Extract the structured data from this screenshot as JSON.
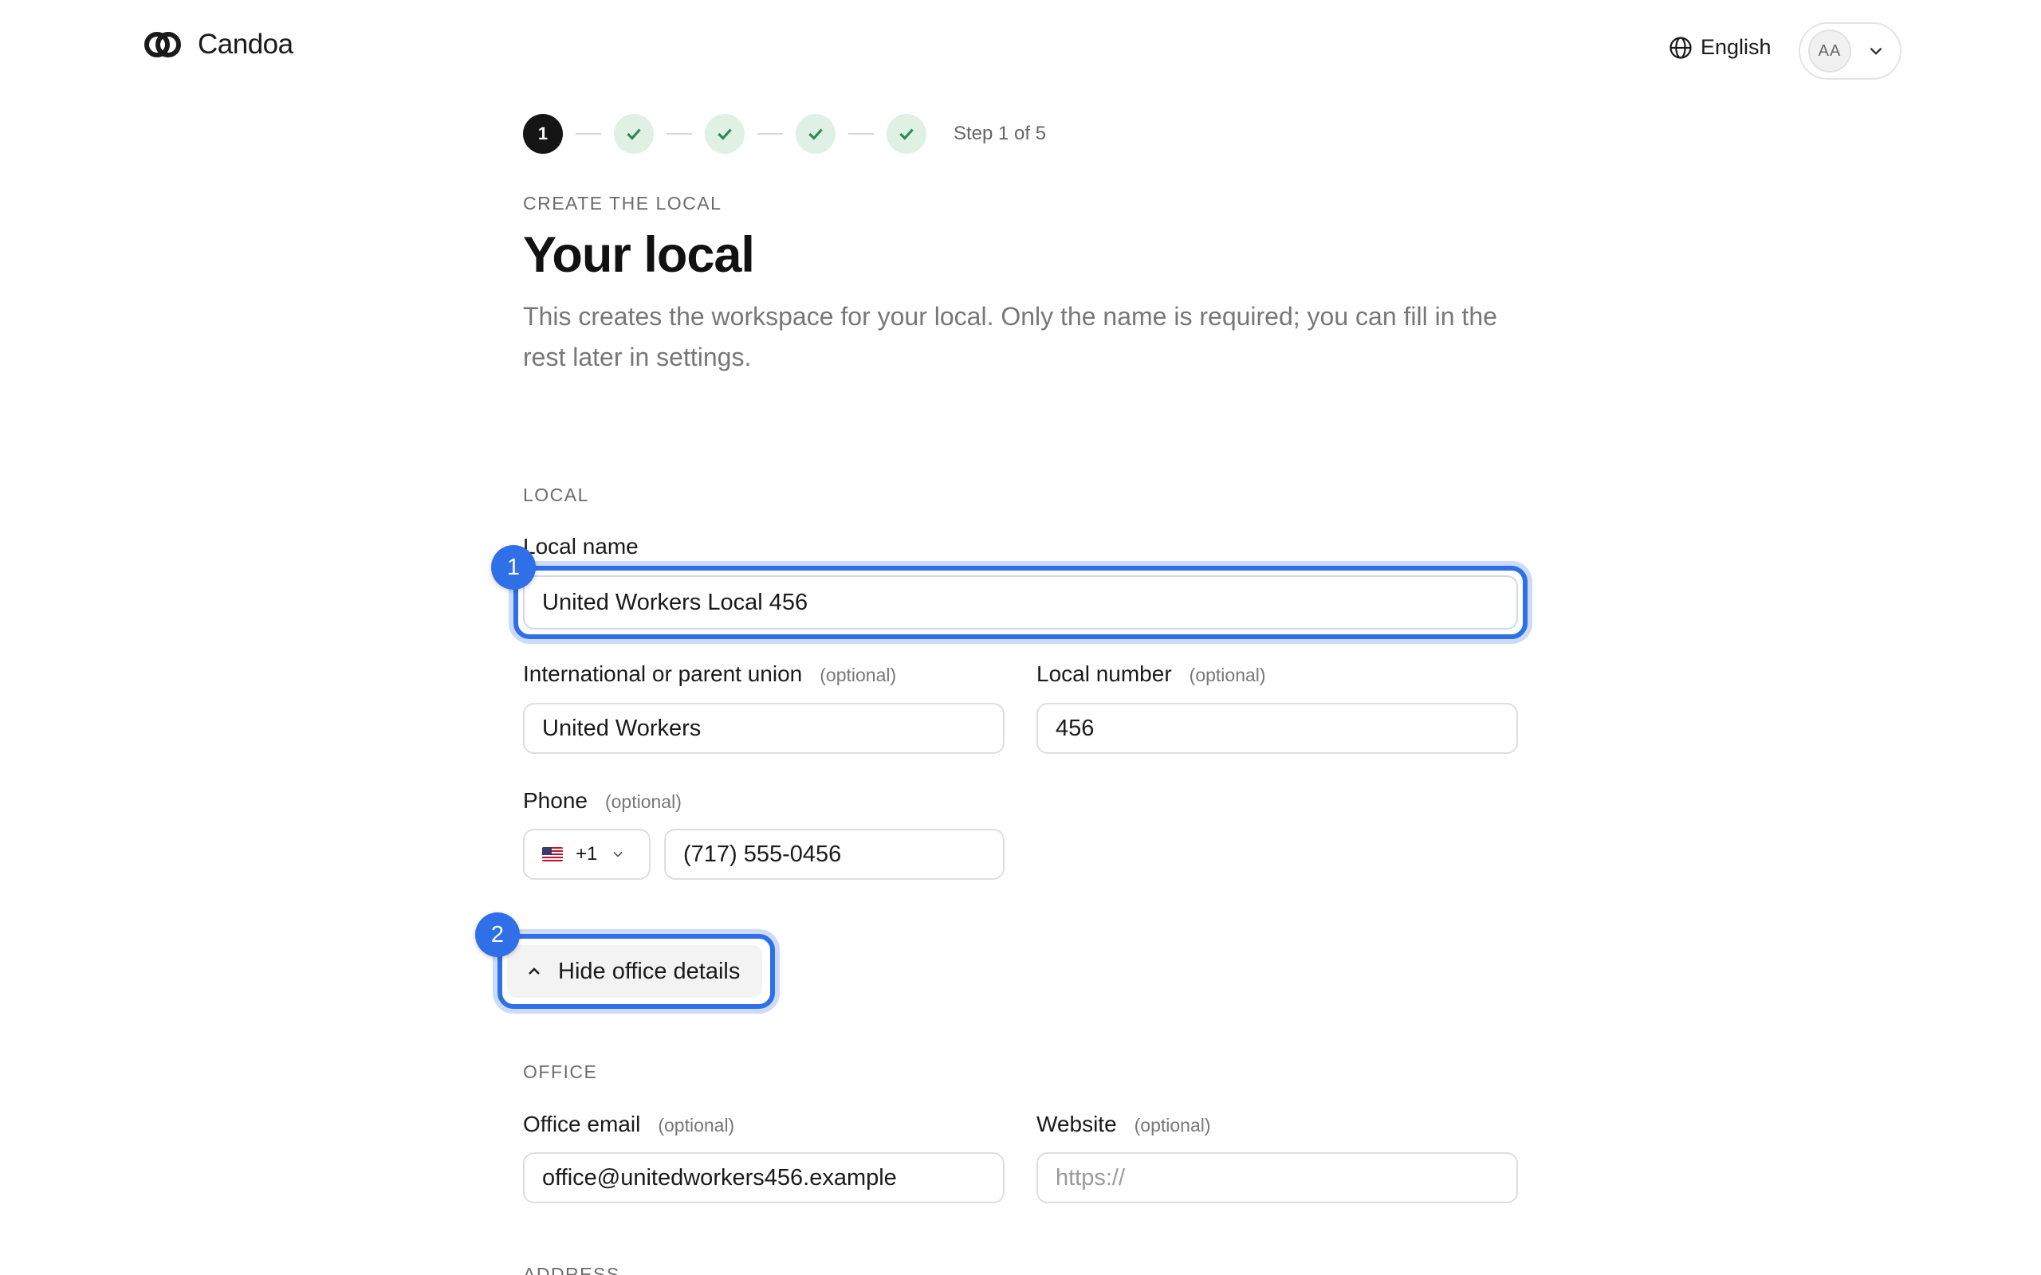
{
  "header": {
    "brand": "Candoa",
    "language": "English",
    "avatar_initials": "AA"
  },
  "stepper": {
    "current": "1",
    "text": "Step 1 of 5",
    "steps": [
      "active",
      "done",
      "done",
      "done",
      "done"
    ]
  },
  "page": {
    "eyebrow": "CREATE THE LOCAL",
    "title": "Your local",
    "intro": "This creates the workspace for your local. Only the name is required; you can fill in the rest later in settings."
  },
  "local": {
    "section": "LOCAL",
    "name_label": "Local name",
    "name_value": "United Workers Local 456",
    "parent_label": "International or parent union",
    "parent_value": "United Workers",
    "number_label": "Local number",
    "number_value": "456",
    "phone_label": "Phone",
    "phone_country_code": "+1",
    "phone_value": "(717) 555-0456",
    "optional": "(optional)"
  },
  "toggle": {
    "label": "Hide office details"
  },
  "office": {
    "section": "OFFICE",
    "email_label": "Office email",
    "email_value": "office@unitedworkers456.example",
    "website_label": "Website",
    "website_placeholder": "https://",
    "next_section": "ADDRESS"
  },
  "annotations": [
    "1",
    "2"
  ],
  "colors": {
    "accent": "#2f6fe8",
    "done_bg": "#dff0e4",
    "done_check": "#2e8b57"
  }
}
